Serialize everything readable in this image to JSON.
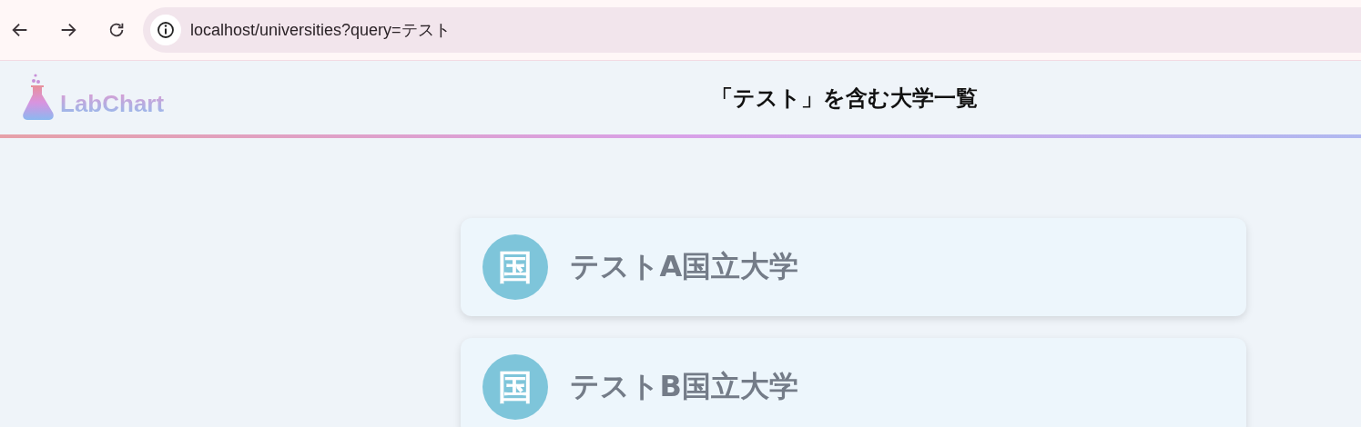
{
  "browser": {
    "url": "localhost/universities?query=テスト"
  },
  "header": {
    "logo": "LabChart",
    "title": "「テスト」を含む大学一覧"
  },
  "universities": [
    {
      "badge": "国",
      "name": "テストA国立大学"
    },
    {
      "badge": "国",
      "name": "テストB国立大学"
    }
  ]
}
